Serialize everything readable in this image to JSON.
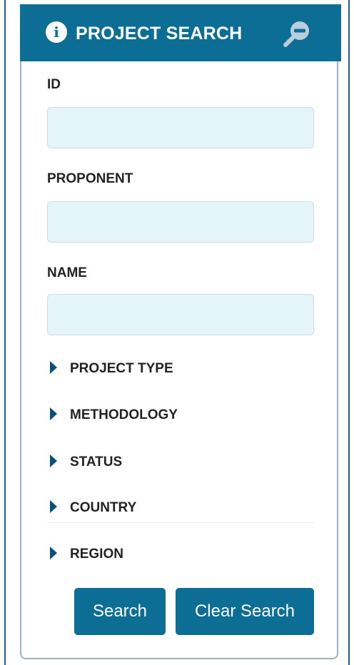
{
  "header": {
    "title": "PROJECT SEARCH",
    "info_glyph": "i",
    "left_icon": "info-circle-icon",
    "right_icon": "zoom-out-icon"
  },
  "fields": [
    {
      "label": "ID",
      "value": "",
      "placeholder": ""
    },
    {
      "label": "PROPONENT",
      "value": "",
      "placeholder": ""
    },
    {
      "label": "NAME",
      "value": "",
      "placeholder": ""
    }
  ],
  "sections": [
    {
      "label": "PROJECT TYPE",
      "expanded": false
    },
    {
      "label": "METHODOLOGY",
      "expanded": false
    },
    {
      "label": "STATUS",
      "expanded": false
    },
    {
      "label": "COUNTRY",
      "expanded": false
    },
    {
      "label": "REGION",
      "expanded": false
    }
  ],
  "buttons": {
    "search_label": "Search",
    "clear_label": "Clear Search"
  },
  "colors": {
    "accent": "#0d6e95",
    "input_bg": "#e3f5f8",
    "caret": "#0d4f7a",
    "frame_border": "#1f5f9a"
  }
}
